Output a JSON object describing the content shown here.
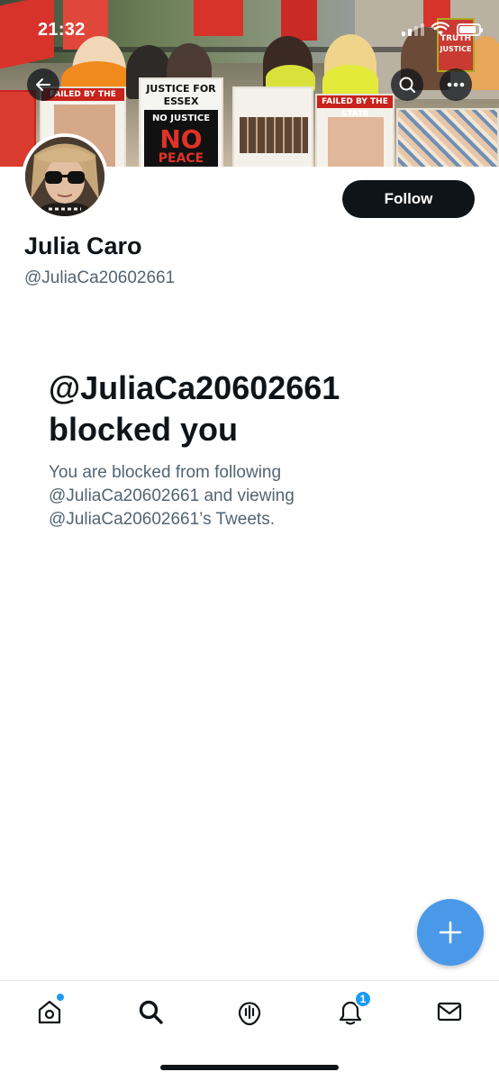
{
  "status_bar": {
    "time": "21:32"
  },
  "banner": {
    "placards": {
      "failed_state": "FAILED BY THE STATE",
      "justice_for": "JUSTICE FOR",
      "essex": "ESSEX",
      "no_justice": "NO JUSTICE",
      "no": "NO",
      "peace": "PEACE",
      "failed_state_2": "FAILED BY THE STATE",
      "truth": "TRUTH",
      "justice": "JUSTICE"
    }
  },
  "profile": {
    "display_name": "Julia Caro",
    "handle": "@JuliaCa20602661",
    "follow_label": "Follow"
  },
  "blocked": {
    "title_line1": "@JuliaCa20602661",
    "title_line2": "blocked you",
    "description": "You are blocked from following @JuliaCa20602661 and viewing @JuliaCa20602661’s Tweets."
  },
  "tabbar": {
    "items": [
      "home-icon",
      "search-icon",
      "spaces-icon",
      "notifications-icon",
      "messages-icon"
    ],
    "notification_count": "1"
  },
  "colors": {
    "accent": "#1d9bf0",
    "fab": "#4a99e9",
    "text": "#0f1419",
    "secondary": "#536471"
  }
}
